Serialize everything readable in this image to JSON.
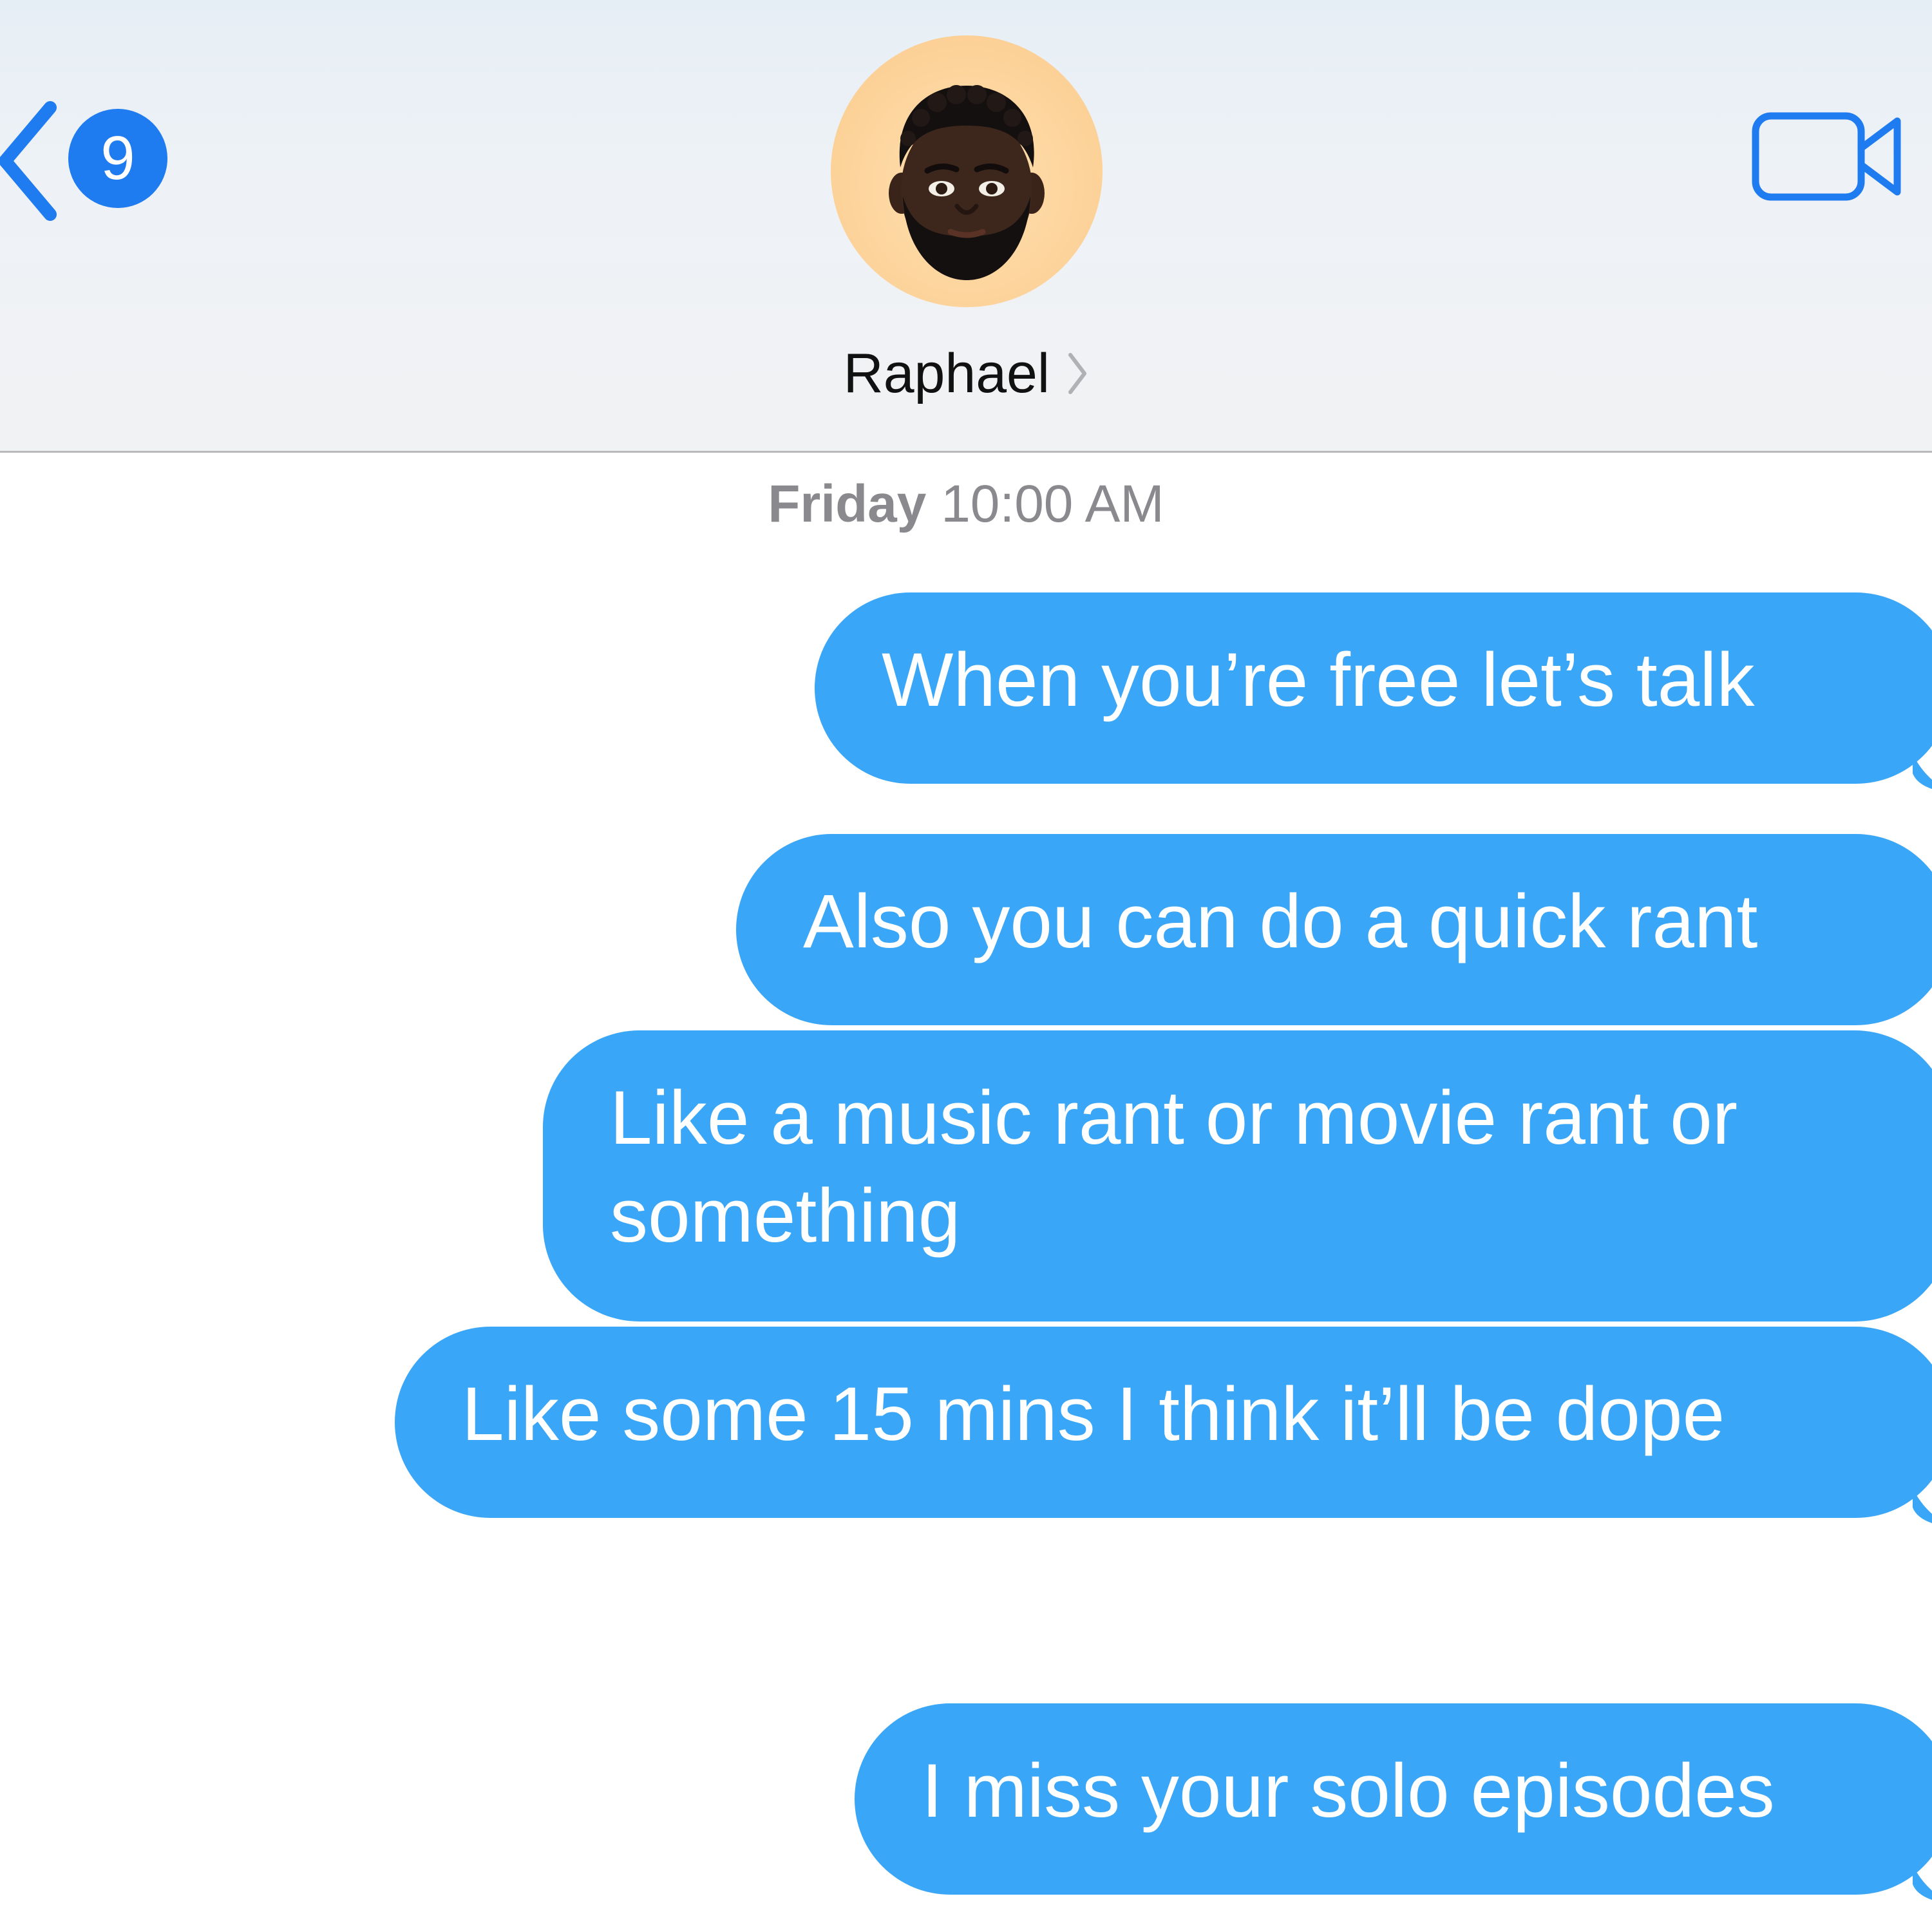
{
  "header": {
    "unread_count": "9",
    "contact_name": "Raphael",
    "avatar_icon": "memoji-avatar-icon",
    "video_icon": "video-camera-icon",
    "back_icon": "chevron-left-icon"
  },
  "thread": {
    "timestamp_day": "Friday",
    "timestamp_time": "10:00 AM",
    "messages": [
      {
        "text": "When you’re free let’s talk",
        "sender": "me"
      },
      {
        "text": "Also you can do a quick rant",
        "sender": "me"
      },
      {
        "text": "Like a music rant or movie rant or something",
        "sender": "me"
      },
      {
        "text": "Like some 15 mins I think it’ll be dope",
        "sender": "me"
      },
      {
        "text": "I miss your solo episodes",
        "sender": "me"
      }
    ]
  },
  "colors": {
    "accent_blue": "#1e7bf0",
    "bubble_blue": "#3aa6f8",
    "avatar_bg": "#fcd197"
  }
}
